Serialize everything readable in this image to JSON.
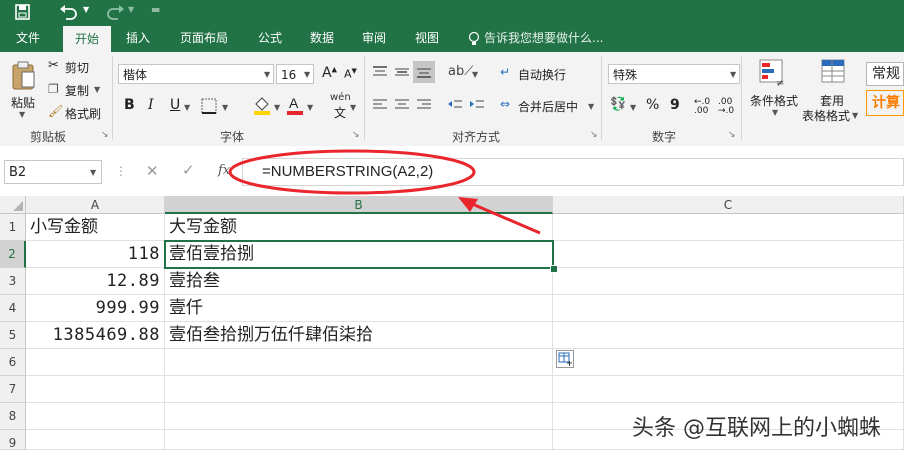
{
  "ribbon_tabs": [
    "文件",
    "开始",
    "插入",
    "页面布局",
    "公式",
    "数据",
    "审阅",
    "视图"
  ],
  "tell_me": "告诉我您想要做什么...",
  "clipboard": {
    "paste": "粘贴",
    "cut": "剪切",
    "copy": "复制",
    "format_painter": "格式刷",
    "label": "剪贴板"
  },
  "font": {
    "name": "楷体",
    "size": "16",
    "label": "字体",
    "bold": "B",
    "italic": "I",
    "underline": "U",
    "color_letter": "A",
    "phonetic": "wén"
  },
  "alignment": {
    "wrap": "自动换行",
    "merge": "合并后居中",
    "label": "对齐方式"
  },
  "number": {
    "format": "特殊",
    "label": "数字",
    "percent": "%",
    "comma": "9"
  },
  "styles": {
    "conditional": "条件格式",
    "table_format_1": "套用",
    "table_format_2": "表格格式",
    "normal": "常规",
    "calc": "计算"
  },
  "formula_bar": {
    "name_box": "B2",
    "fx": "fx",
    "formula": "=NUMBERSTRING(A2,2)"
  },
  "columns": [
    "A",
    "B",
    "C"
  ],
  "rows": [
    "1",
    "2",
    "3",
    "4",
    "5",
    "6",
    "7",
    "8",
    "9"
  ],
  "cells": {
    "A1": "小写金额",
    "B1": "大写金额",
    "A2": "118",
    "B2": "壹佰壹拾捌",
    "A3": "12.89",
    "B3": "壹拾叁",
    "A4": "999.99",
    "B4": "壹仟",
    "A5": "1385469.88",
    "B5": "壹佰叁拾捌万伍仟肆佰柒拾"
  },
  "watermark": "头条 @互联网上的小蜘蛛",
  "colors": {
    "excel_green": "#217346",
    "annotation_red": "#e8262c",
    "selection": "#217346"
  }
}
